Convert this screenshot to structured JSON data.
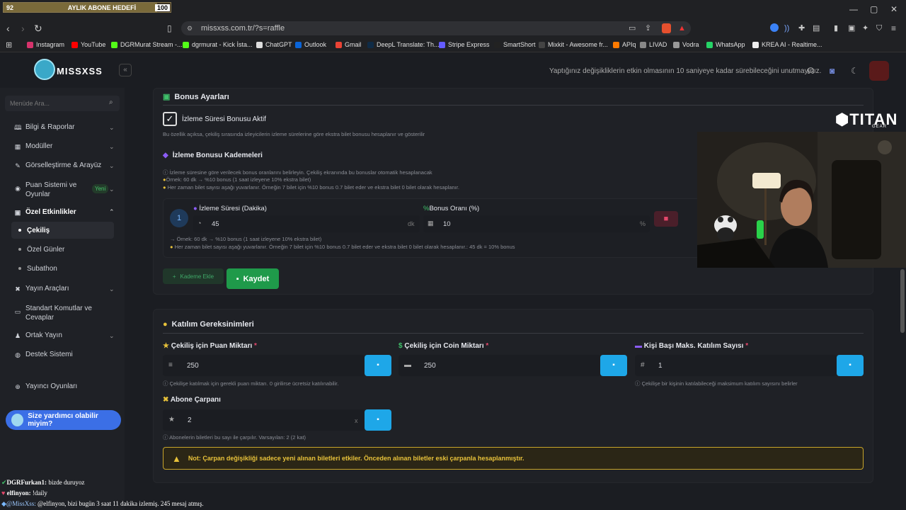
{
  "subscriber_goal": {
    "current": "92",
    "label": "AYLIK ABONE HEDEFİ",
    "target": "100",
    "progress": 0.92
  },
  "browser": {
    "url": "missxss.com.tr/?s=raffle",
    "bookmarks": [
      {
        "label": "Instagram",
        "color": "#d6336c"
      },
      {
        "label": "YouTube",
        "color": "#ff0000"
      },
      {
        "label": "DGRMurat Stream -...",
        "color": "#53fc18"
      },
      {
        "label": "dgrmurat - Kick İsta...",
        "color": "#53fc18"
      },
      {
        "label": "ChatGPT",
        "color": "#dddddd"
      },
      {
        "label": "Outlook",
        "color": "#0a64d8"
      },
      {
        "label": "Gmail",
        "color": "#ea4335"
      },
      {
        "label": "DeepL Translate: Th...",
        "color": "#0f2b46"
      },
      {
        "label": "Stripe Express",
        "color": "#635bff"
      },
      {
        "label": "SmartShort",
        "color": "#222222"
      },
      {
        "label": "Mixkit - Awesome fr...",
        "color": "#444444"
      },
      {
        "label": "APIq",
        "color": "#ff7a00"
      },
      {
        "label": "LIVAD",
        "color": "#888888"
      },
      {
        "label": "Vodra",
        "color": "#999999"
      },
      {
        "label": "WhatsApp",
        "color": "#25d366"
      },
      {
        "label": "KREA AI - Realtime...",
        "color": "#eeeeee"
      }
    ]
  },
  "header": {
    "logo_text": "MISSXSS",
    "message": "Yaptığınız değişikliklerin etkin olmasının 10 saniyeye kadar sürebileceğini unutmayınız."
  },
  "sidebar": {
    "search_placeholder": "Menüde Ara...",
    "items": [
      {
        "label": "Bilgi & Raporlar",
        "icon": "🕮"
      },
      {
        "label": "Modüller",
        "icon": "▦"
      },
      {
        "label": "Görselleştirme & Arayüz",
        "icon": "✎"
      },
      {
        "label": "Puan Sistemi ve",
        "label2": "Oyunlar",
        "icon": "◉"
      },
      {
        "label": "Özel Etkinlikler",
        "icon": "▣"
      }
    ],
    "new_badge": "Yeni",
    "subitems": [
      {
        "label": "Çekiliş"
      },
      {
        "label": "Özel Günler"
      },
      {
        "label": "Subathon"
      }
    ],
    "items2": [
      {
        "label": "Yayın Araçları",
        "icon": "✖"
      },
      {
        "label": "Standart Komutlar ve",
        "label2": "Cevaplar",
        "icon": "▭"
      },
      {
        "label": "Ortak Yayın",
        "icon": "♟"
      },
      {
        "label": "Destek Sistemi",
        "icon": "◍"
      },
      {
        "label": "Yayıncı Oyunları",
        "icon": "⊕"
      }
    ],
    "help_button": "Size yardımcı olabilir miyim?"
  },
  "bonus": {
    "title": "Bonus Ayarları",
    "checkbox_label": "İzleme Süresi Bonusu Aktif",
    "checkbox_desc": "Bu özellik açıksa, çekiliş sırasında izleyicilerin izleme sürelerine göre ekstra bilet bonusu hesaplanır ve gösterilir",
    "tiers_title": "İzleme Bonusu Kademeleri",
    "info1": "İzleme süresine göre verilecek bonus oranlarını belirleyin. Çekiliş ekranında bu bonuslar otomatik hesaplanacak",
    "info2": "Örnek: 60 dk → %10 bonus (1 saat izleyene 10% ekstra bilet)",
    "info3": "Her zaman bilet sayısı aşağı yuvarlanır. Örneğin 7 bilet için %10 bonus 0.7 bilet eder ve ekstra bilet 0 bilet olarak hesaplanır.",
    "tier": {
      "index": "1",
      "duration_label": "İzleme Süresi (Dakika)",
      "duration_value": "45",
      "duration_unit": "dk",
      "rate_label": "Bonus Oranı (%)",
      "rate_value": "10",
      "rate_unit": "%",
      "hint1": "Örnek: 60 dk → %10 bonus (1 saat izleyene 10% ekstra bilet)",
      "hint2": "Her zaman bilet sayısı aşağı yuvarlanır. Örneğin 7 bilet için %10 bonus 0.7 bilet eder ve ekstra bilet 0 bilet olarak hesaplanır.: 45 dk = 10% bonus"
    },
    "add_tier": "Kademe Ekle",
    "save": "Kaydet"
  },
  "participation": {
    "title": "Katılım Gereksinimleri",
    "points_label": "Çekiliş için Puan Miktarı",
    "points_value": "250",
    "points_desc": "Çekilişe katılmak için gerekli puan miktarı. 0 girilirse ücretsiz katılınabilir.",
    "coin_label": "Çekiliş için Coin Miktarı",
    "coin_value": "250",
    "max_label": "Kişi Başı Maks. Katılım Sayısı",
    "max_value": "1",
    "max_desc": "Çekilişe bir kişinin katılabileceği maksimum katılım sayısını belirler",
    "multiplier_label": "Abone Çarpanı",
    "multiplier_value": "2",
    "multiplier_unit": "x",
    "multiplier_desc": "Abonelerin biletleri bu sayı ile çarpılır. Varsayılan: 2 (2 kat)",
    "required_mark": "*",
    "note": "Not: Çarpan değişikliği sadece yeni alınan biletleri etkiler. Önceden alınan biletler eski çarpanla hesaplanmıştır."
  },
  "overlay": {
    "brand": "TITAN",
    "brand_sub": "GEAR"
  },
  "chat": [
    {
      "user": "DGRFurkan1:",
      "text": "bizde duruyoz",
      "color": "#ffffff"
    },
    {
      "user": "elfinyon:",
      "text": "!daily",
      "color": "#ffffff"
    },
    {
      "user": "@MissXss:",
      "text": "@elfinyon, bizi bugün 3 saat 11 dakika izlemiş. 245 mesaj atmış.",
      "color": "#9ec9ff"
    }
  ]
}
